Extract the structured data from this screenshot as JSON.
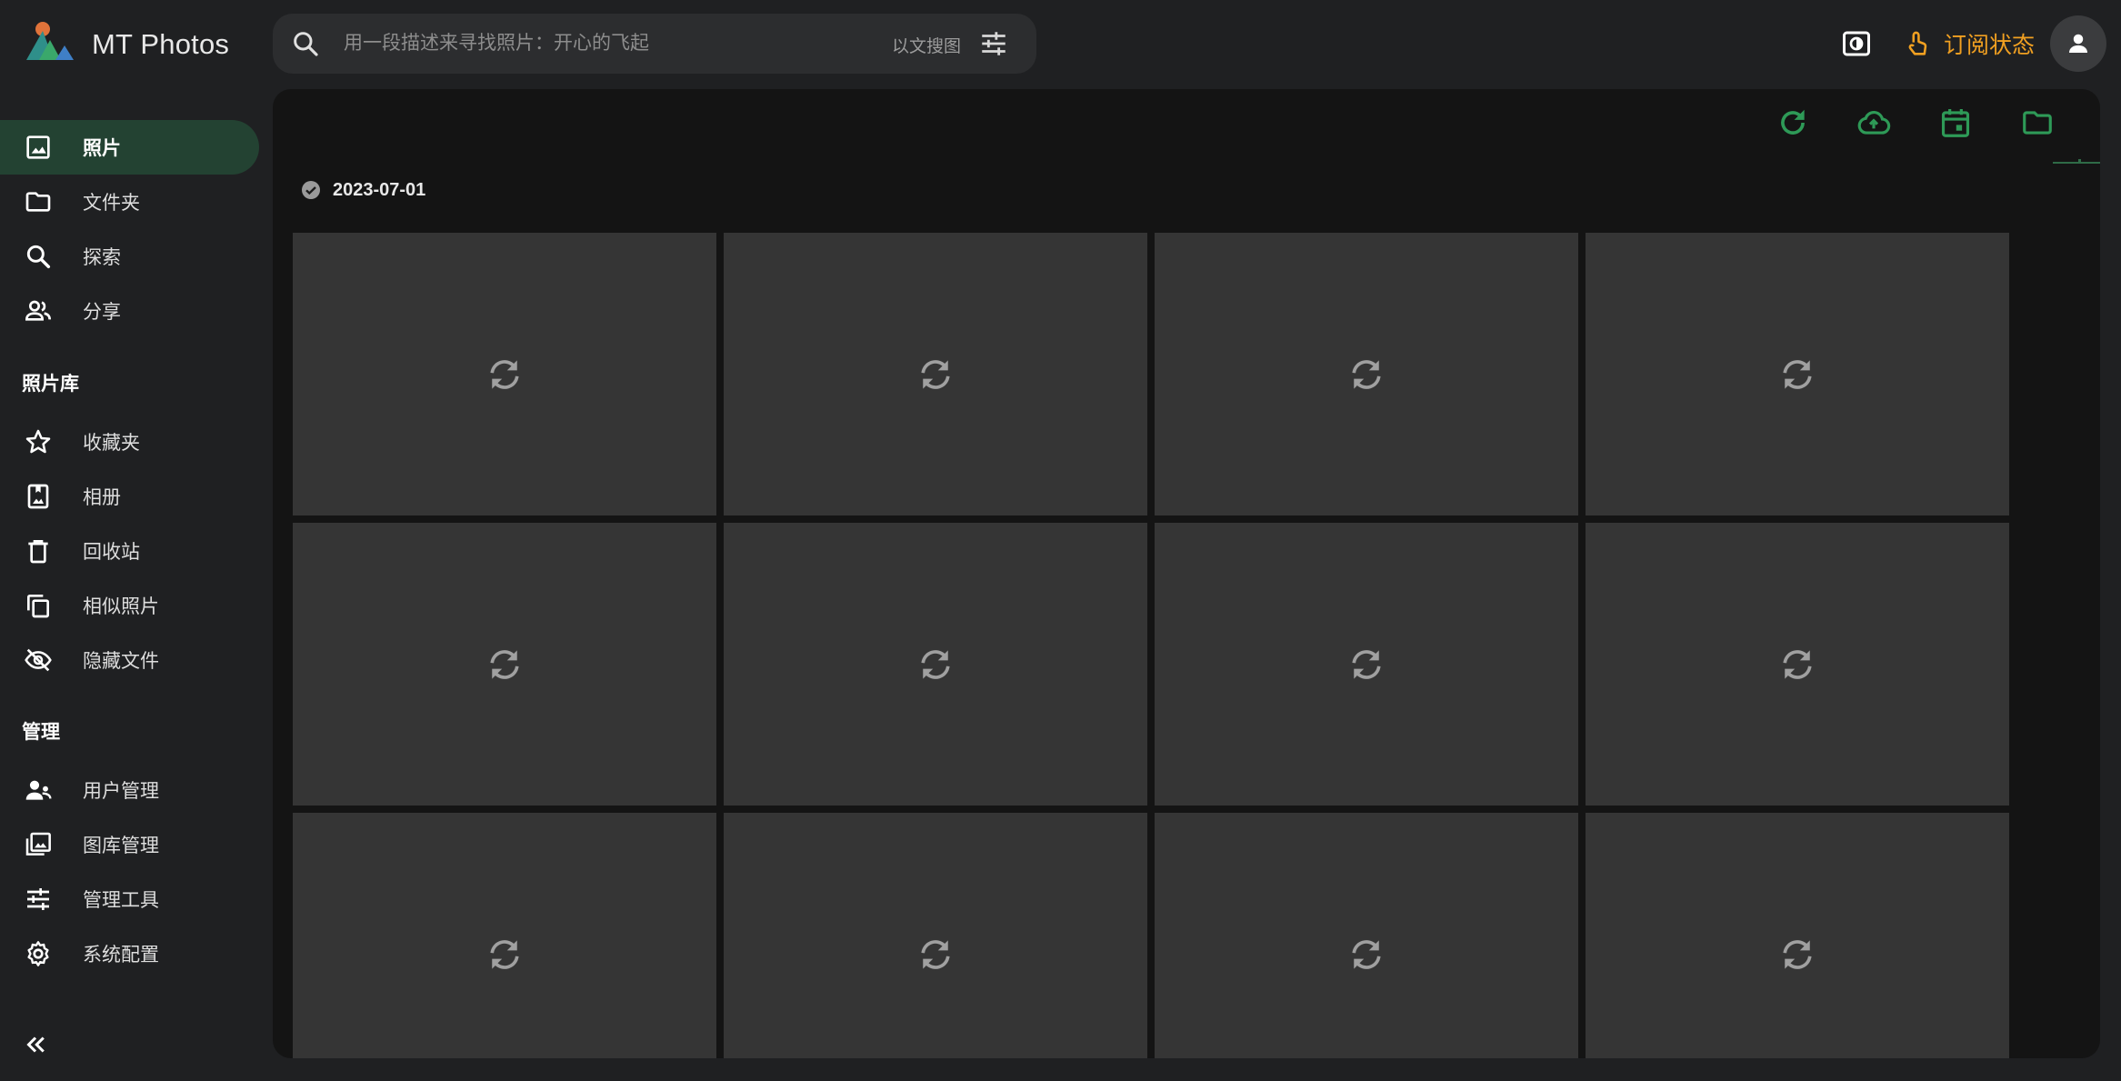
{
  "app": {
    "title": "MT Photos"
  },
  "search": {
    "placeholder": "用一段描述来寻找照片：开心的飞起",
    "image_search_label": "以文搜图"
  },
  "header": {
    "subscribe_label": "订阅状态"
  },
  "sidebar": {
    "items": [
      {
        "label": "照片",
        "icon": "image-icon",
        "active": true
      },
      {
        "label": "文件夹",
        "icon": "folder-icon"
      },
      {
        "label": "探索",
        "icon": "search-icon"
      },
      {
        "label": "分享",
        "icon": "people-icon"
      }
    ],
    "library_title": "照片库",
    "library_items": [
      {
        "label": "收藏夹",
        "icon": "star-icon"
      },
      {
        "label": "相册",
        "icon": "album-icon"
      },
      {
        "label": "回收站",
        "icon": "trash-icon"
      },
      {
        "label": "相似照片",
        "icon": "copy-icon"
      },
      {
        "label": "隐藏文件",
        "icon": "eye-off-icon"
      }
    ],
    "admin_title": "管理",
    "admin_items": [
      {
        "label": "用户管理",
        "icon": "user-manage-icon"
      },
      {
        "label": "图库管理",
        "icon": "photo-library-icon"
      },
      {
        "label": "管理工具",
        "icon": "tune-icon"
      },
      {
        "label": "系统配置",
        "icon": "gear-icon"
      }
    ]
  },
  "main": {
    "date_group": "2023-07-01",
    "toolbar_icons": [
      "refresh-icon",
      "cloud-upload-icon",
      "calendar-icon",
      "folder-icon"
    ],
    "tile_icon": "sync-icon",
    "tile_count": 12
  },
  "colors": {
    "accent": "#2e9a57",
    "subscribe": "#f1a021",
    "active_nav_bg": "#234232"
  }
}
